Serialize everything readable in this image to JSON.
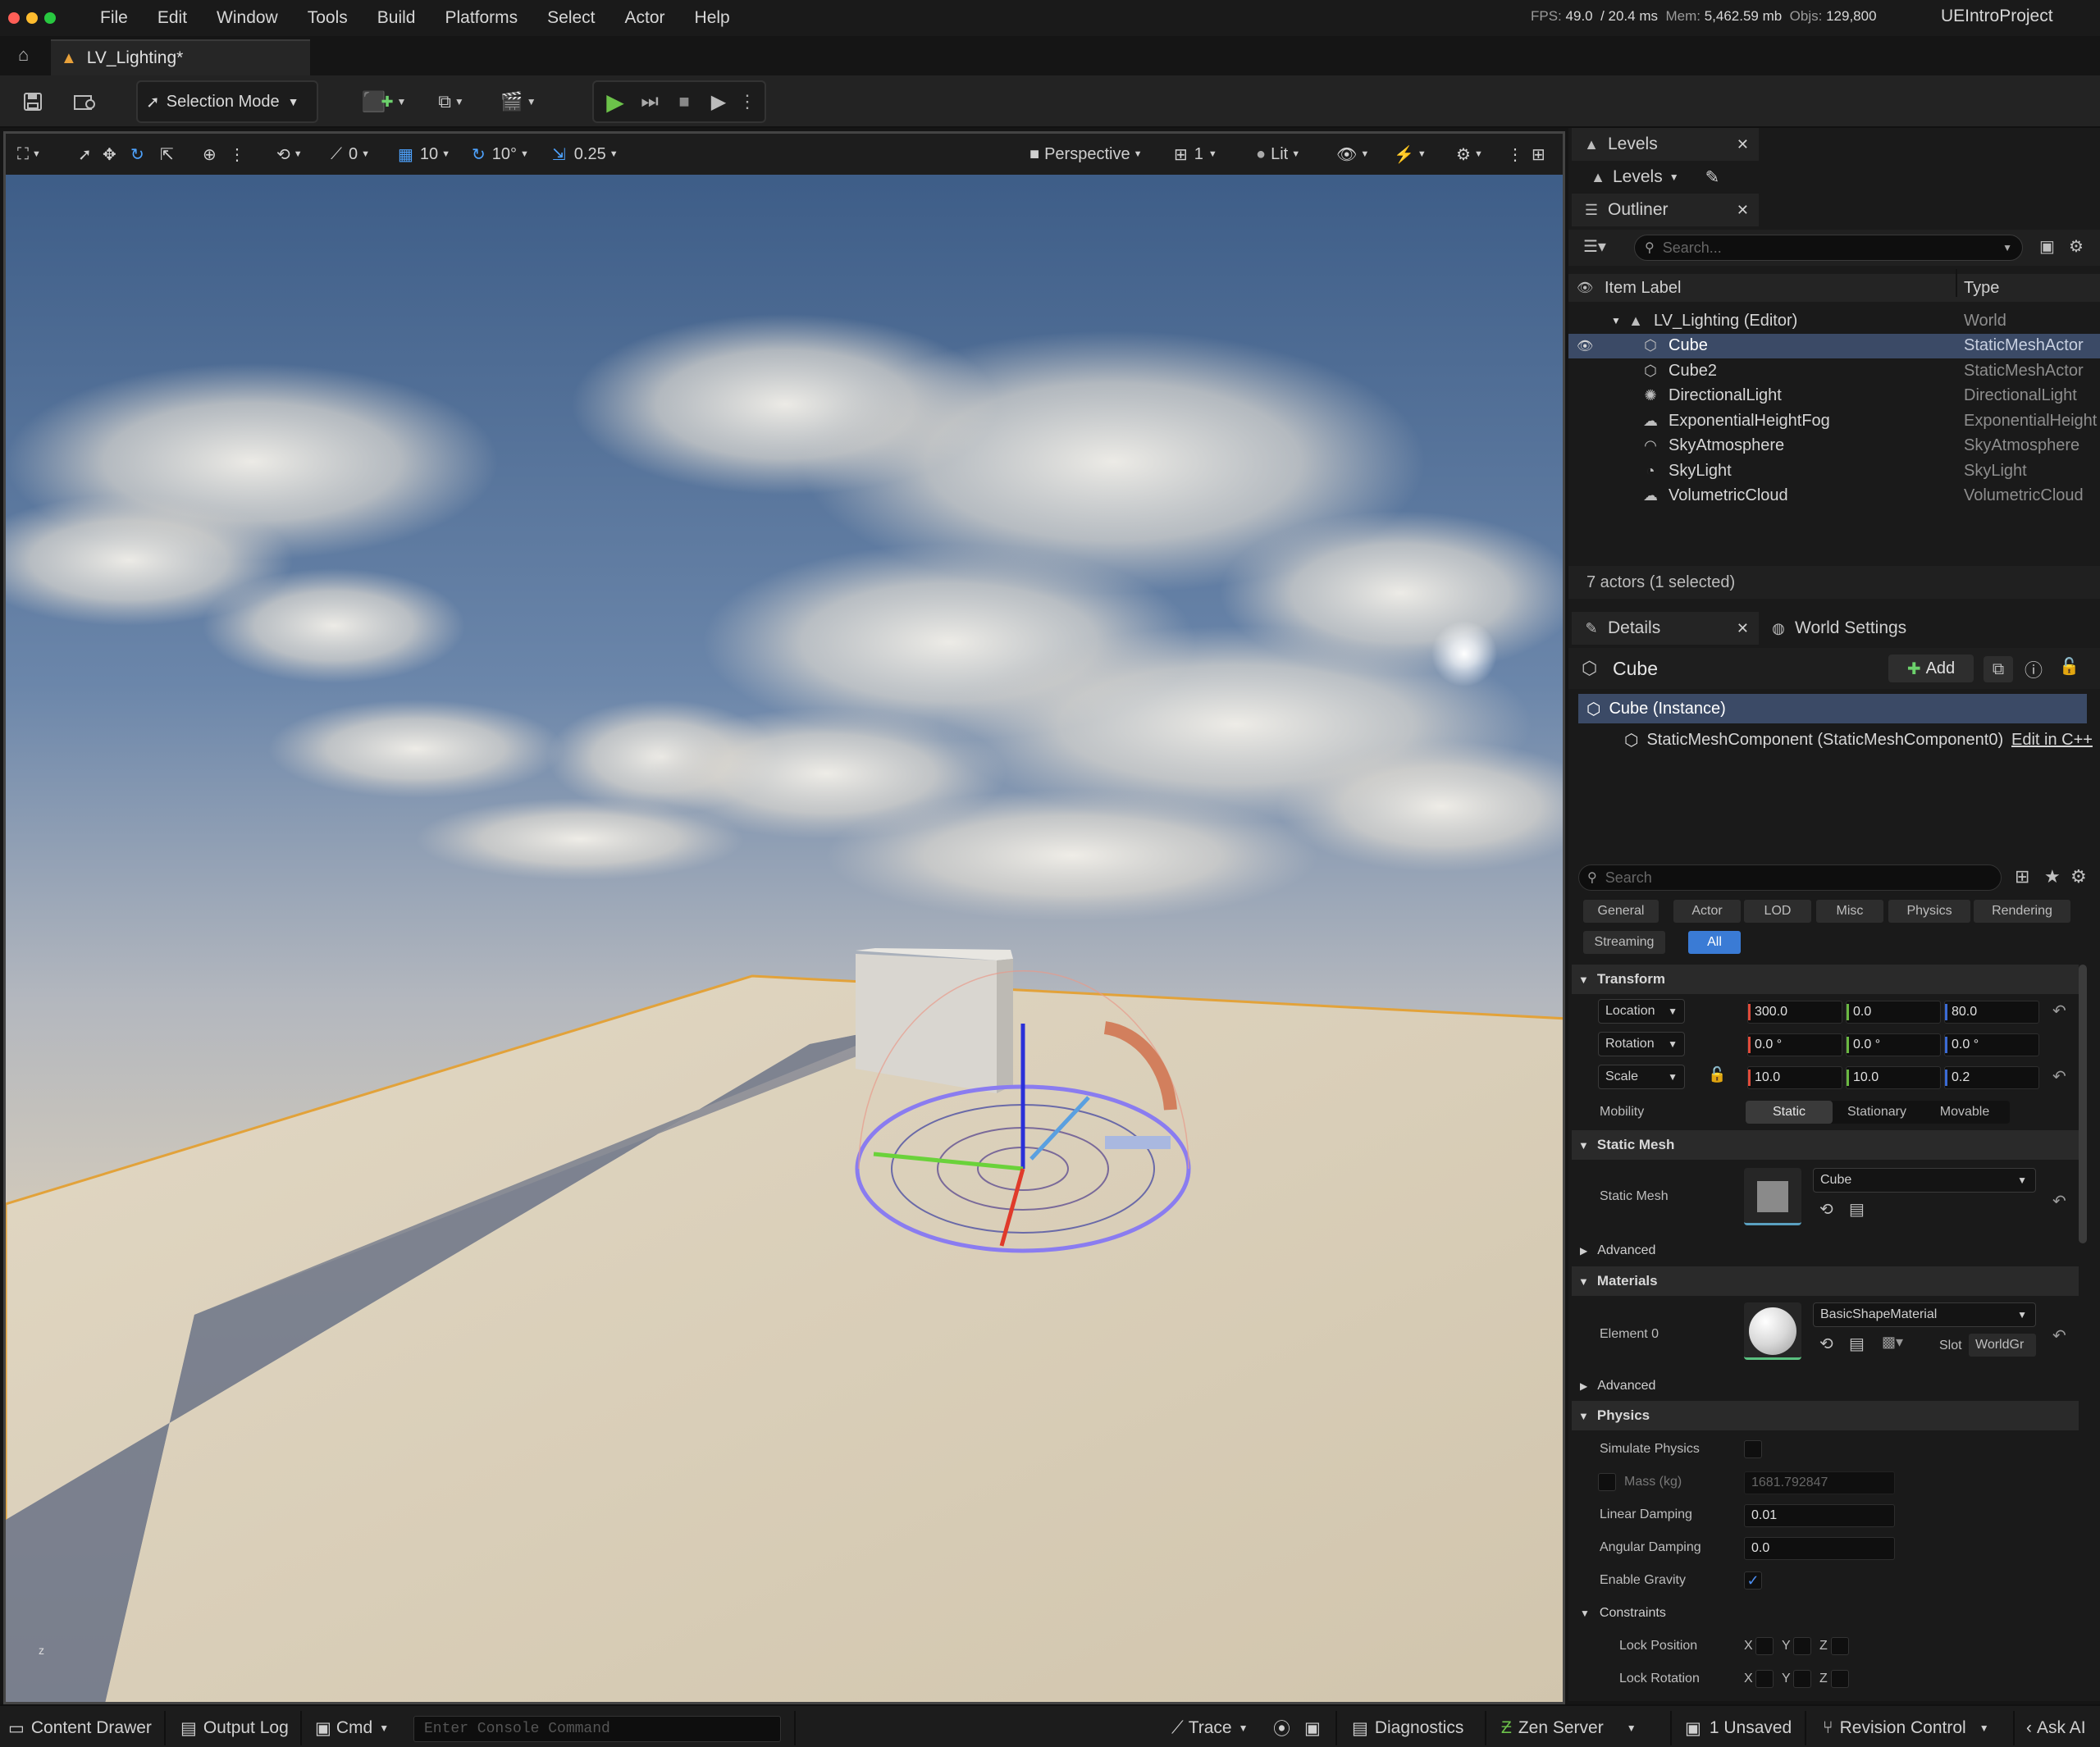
{
  "menubar": {
    "items": [
      "File",
      "Edit",
      "Window",
      "Tools",
      "Build",
      "Platforms",
      "Select",
      "Actor",
      "Help"
    ],
    "stats": {
      "fps_label": "FPS:",
      "fps": "49.0",
      "ms": "/ 20.4 ms",
      "mem_label": "Mem:",
      "mem": "5,462.59 mb",
      "objs_label": "Objs:",
      "objs": "129,800"
    },
    "project": "UEIntroProject"
  },
  "tab": {
    "title": "LV_Lighting*"
  },
  "toolbar": {
    "selection_mode": "Selection Mode"
  },
  "viewport": {
    "snap_rotate_value": "0",
    "grid_value": "10",
    "rotation_snap": "10°",
    "scale_snap": "0.25",
    "view_mode": "Perspective",
    "cam_speed": "1",
    "lit": "Lit"
  },
  "levels_panel": {
    "tab": "Levels",
    "dropdown": "Levels"
  },
  "outliner": {
    "tab": "Outliner",
    "search_placeholder": "Search...",
    "col_label": "Item Label",
    "col_type": "Type",
    "rows": [
      {
        "label": "LV_Lighting (Editor)",
        "type": "World",
        "icon": "world-icon"
      },
      {
        "label": "Cube",
        "type": "StaticMeshActor",
        "icon": "cube-icon"
      },
      {
        "label": "Cube2",
        "type": "StaticMeshActor",
        "icon": "cube-icon"
      },
      {
        "label": "DirectionalLight",
        "type": "DirectionalLight",
        "icon": "sun-icon"
      },
      {
        "label": "ExponentialHeightFog",
        "type": "ExponentialHeight",
        "icon": "fog-icon"
      },
      {
        "label": "SkyAtmosphere",
        "type": "SkyAtmosphere",
        "icon": "atmosphere-icon"
      },
      {
        "label": "SkyLight",
        "type": "SkyLight",
        "icon": "skylight-icon"
      },
      {
        "label": "VolumetricCloud",
        "type": "VolumetricCloud",
        "icon": "cloud-icon"
      }
    ],
    "footer": "7 actors (1 selected)"
  },
  "details": {
    "tab": "Details",
    "world_settings_tab": "World Settings",
    "actor_name": "Cube",
    "add_label": "Add",
    "instance_label": "Cube (Instance)",
    "component_label": "StaticMeshComponent (StaticMeshComponent0)",
    "edit_cpp": "Edit in C++",
    "search_placeholder": "Search",
    "filters": [
      "General",
      "Actor",
      "LOD",
      "Misc",
      "Physics",
      "Rendering",
      "Streaming",
      "All"
    ],
    "transform": {
      "title": "Transform",
      "location_label": "Location",
      "location": [
        "300.0",
        "0.0",
        "80.0"
      ],
      "rotation_label": "Rotation",
      "rotation": [
        "0.0 °",
        "0.0 °",
        "0.0 °"
      ],
      "scale_label": "Scale",
      "scale": [
        "10.0",
        "10.0",
        "0.2"
      ],
      "mobility_label": "Mobility",
      "mobility_options": [
        "Static",
        "Stationary",
        "Movable"
      ]
    },
    "static_mesh": {
      "title": "Static Mesh",
      "label": "Static Mesh",
      "value": "Cube",
      "advanced": "Advanced"
    },
    "materials": {
      "title": "Materials",
      "element_label": "Element 0",
      "value": "BasicShapeMaterial",
      "slot_label": "Slot",
      "slot_value": "WorldGr",
      "advanced": "Advanced"
    },
    "physics": {
      "title": "Physics",
      "simulate": "Simulate Physics",
      "mass_label": "Mass (kg)",
      "mass": "1681.792847",
      "linear_label": "Linear Damping",
      "linear": "0.01",
      "angular_label": "Angular Damping",
      "angular": "0.0",
      "gravity_label": "Enable Gravity",
      "constraints": "Constraints",
      "lock_pos": "Lock Position",
      "lock_rot": "Lock Rotation",
      "x": "X",
      "y": "Y",
      "z": "Z"
    }
  },
  "statusbar": {
    "content_drawer": "Content Drawer",
    "output_log": "Output Log",
    "cmd": "Cmd",
    "console_placeholder": "Enter Console Command",
    "trace": "Trace",
    "diagnostics": "Diagnostics",
    "zen": "Zen Server",
    "unsaved": "1 Unsaved",
    "revision": "Revision Control",
    "ask_ai": "Ask AI"
  }
}
